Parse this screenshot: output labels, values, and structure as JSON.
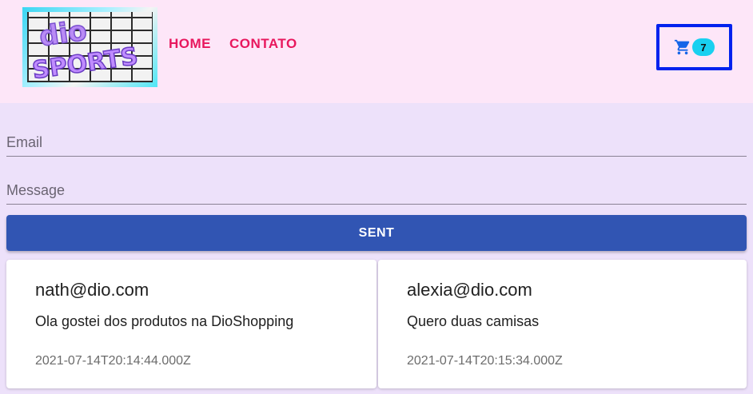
{
  "header": {
    "logo_text_top": "dio",
    "logo_text_bottom": "SPORTS",
    "nav": [
      {
        "label": "HOME"
      },
      {
        "label": "CONTATO"
      }
    ],
    "cart": {
      "icon": "cart-icon",
      "count": "7"
    },
    "colors": {
      "background": "#fde6f8",
      "nav": "#e8175d",
      "cart_border": "#0022ee",
      "badge": "#19d0f0"
    }
  },
  "form": {
    "email_placeholder": "Email",
    "message_placeholder": "Message",
    "submit_label": "SENT",
    "submit_color": "#3155b3"
  },
  "messages": [
    {
      "email": "nath@dio.com",
      "message": "Ola gostei dos produtos na DioShopping",
      "timestamp": "2021-07-14T20:14:44.000Z"
    },
    {
      "email": "alexia@dio.com",
      "message": "Quero duas camisas",
      "timestamp": "2021-07-14T20:15:34.000Z"
    }
  ]
}
